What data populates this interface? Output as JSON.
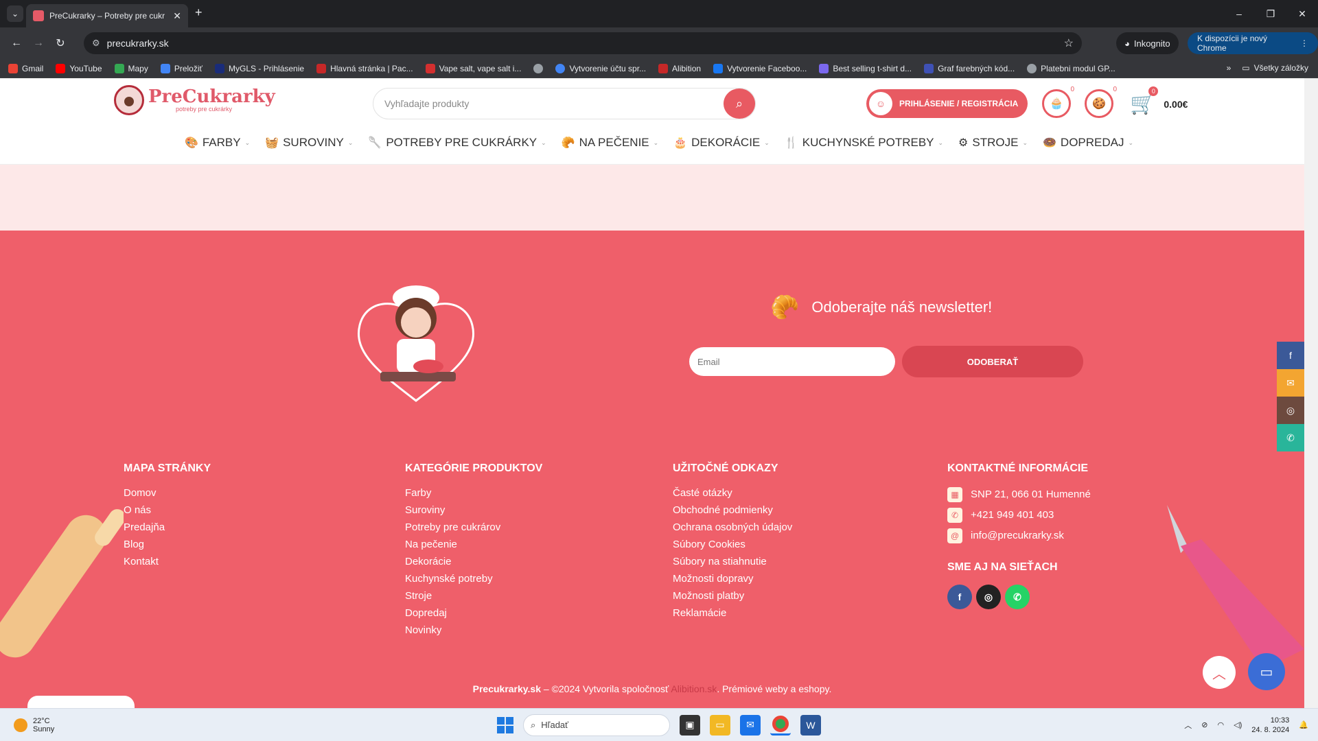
{
  "browser": {
    "tab_title": "PreCukrarky – Potreby pre cukr",
    "url": "precukrarky.sk",
    "incognito_label": "Inkognito",
    "update_label": "K dispozícii je nový Chrome",
    "bookmarks": [
      {
        "label": "Gmail",
        "color": "#ea4335"
      },
      {
        "label": "YouTube",
        "color": "#ff0000"
      },
      {
        "label": "Mapy",
        "color": "#34a853"
      },
      {
        "label": "Preložiť",
        "color": "#4285f4"
      },
      {
        "label": "MyGLS - Prihlásenie",
        "color": "#1a2c7a"
      },
      {
        "label": "Hlavná stránka | Pac...",
        "color": "#c62828"
      },
      {
        "label": "Vape salt, vape salt i...",
        "color": "#d32f2f"
      },
      {
        "label": "",
        "color": "#9aa0a6"
      },
      {
        "label": "Vytvorenie účtu spr...",
        "color": "#4285f4"
      },
      {
        "label": "Alibition",
        "color": "#c62828"
      },
      {
        "label": "Vytvorenie Faceboo...",
        "color": "#1877f2"
      },
      {
        "label": "Best selling t-shirt d...",
        "color": "#7b68ee"
      },
      {
        "label": "Graf farebných kód...",
        "color": "#3f51b5"
      },
      {
        "label": "Platebni modul GP...",
        "color": "#9aa0a6"
      }
    ],
    "all_bookmarks_label": "Všetky záložky"
  },
  "header": {
    "logo_text": "PreCukrarky",
    "logo_sub": "potreby pre cukrárky",
    "search_placeholder": "Vyhľadajte produkty",
    "login_label": "PRIHLÁSENIE / REGISTRÁCIA",
    "wishlist_count": "0",
    "compare_count": "0",
    "cart_count": "0",
    "cart_total": "0.00€"
  },
  "nav": [
    {
      "label": "FARBY",
      "icon": "paint-icon"
    },
    {
      "label": "SUROVINY",
      "icon": "basket-icon"
    },
    {
      "label": "POTREBY PRE CUKRÁRKY",
      "icon": "whisk-icon"
    },
    {
      "label": "NA PEČENIE",
      "icon": "baking-icon"
    },
    {
      "label": "DEKORÁCIE",
      "icon": "decoration-icon"
    },
    {
      "label": "KUCHYNSKÉ POTREBY",
      "icon": "utensils-icon"
    },
    {
      "label": "STROJE",
      "icon": "mixer-icon"
    },
    {
      "label": "DOPREDAJ",
      "icon": "sale-icon"
    }
  ],
  "newsletter": {
    "title": "Odoberajte náš newsletter!",
    "email_placeholder": "Email",
    "button": "ODOBERAŤ"
  },
  "footer": {
    "sitemap": {
      "title": "MAPA STRÁNKY",
      "links": [
        "Domov",
        "O nás",
        "Predajňa",
        "Blog",
        "Kontakt"
      ]
    },
    "categories": {
      "title": "KATEGÓRIE PRODUKTOV",
      "links": [
        "Farby",
        "Suroviny",
        "Potreby pre cukrárov",
        "Na pečenie",
        "Dekorácie",
        "Kuchynské potreby",
        "Stroje",
        "Dopredaj",
        "Novinky"
      ]
    },
    "useful": {
      "title": "UŽITOČNÉ ODKAZY",
      "links": [
        "Časté otázky",
        "Obchodné podmienky",
        "Ochrana osobných údajov",
        "Súbory Cookies",
        "Súbory na stiahnutie",
        "Možnosti dopravy",
        "Možnosti platby",
        "Reklamácie"
      ]
    },
    "contact": {
      "title": "KONTAKTNÉ INFORMÁCIE",
      "address": "SNP 21, 066 01 Humenné",
      "phone": "+421 949 401 403",
      "email": "info@precukrarky.sk",
      "social_title": "SME AJ NA SIEŤACH"
    },
    "copyright_site": "Precukrarky.sk",
    "copyright_text": " – ©2024 Vytvorila spoločnosť ",
    "copyright_brand": "Alibition.sk",
    "copyright_tail": ". Prémiové weby a eshopy."
  },
  "taskbar": {
    "temperature": "22°C",
    "weather": "Sunny",
    "search_placeholder": "Hľadať",
    "time": "10:33",
    "date": "24. 8. 2024"
  },
  "colors": {
    "brand": "#ef5f6a",
    "accent": "#e85a62"
  }
}
